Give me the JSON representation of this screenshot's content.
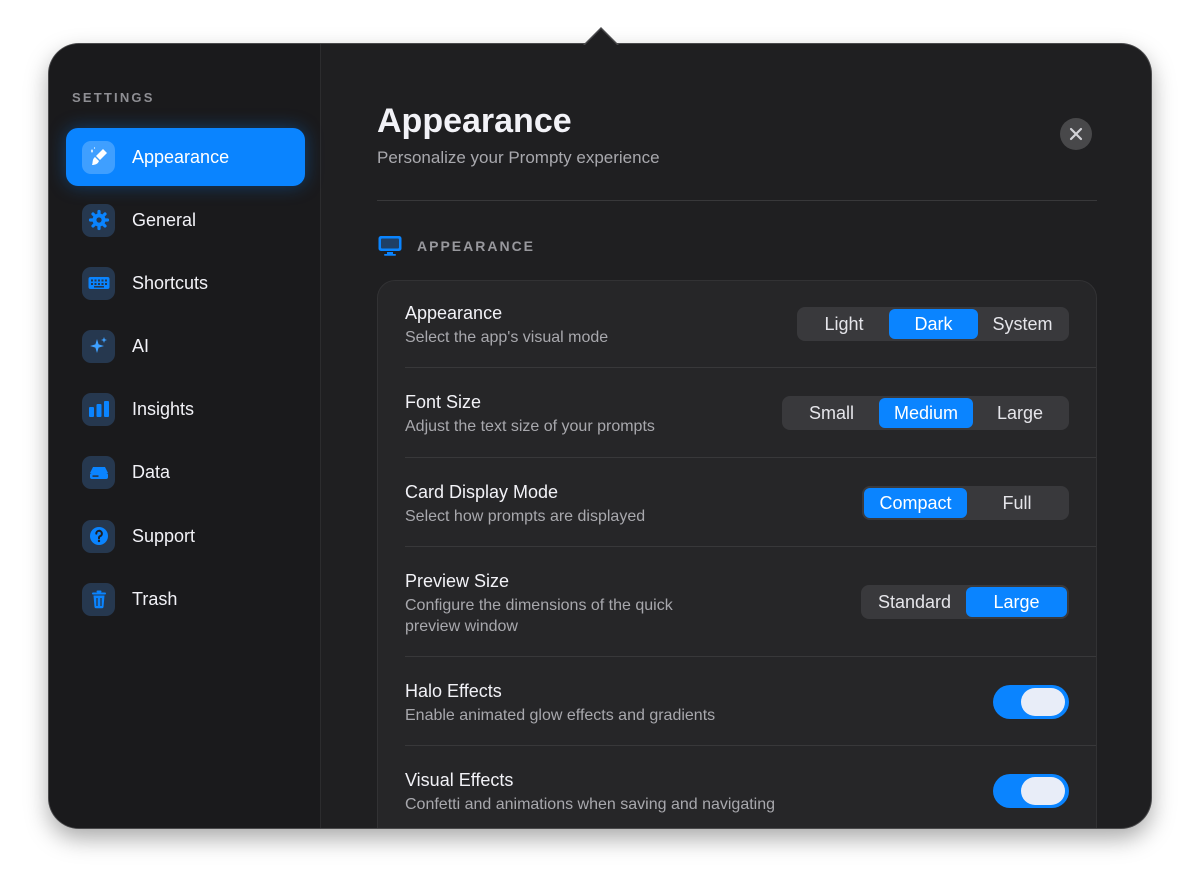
{
  "sidebar": {
    "heading": "SETTINGS",
    "items": [
      {
        "label": "Appearance",
        "icon": "paintbrush-icon",
        "active": true
      },
      {
        "label": "General",
        "icon": "gear-icon"
      },
      {
        "label": "Shortcuts",
        "icon": "keyboard-icon"
      },
      {
        "label": "AI",
        "icon": "sparkles-icon"
      },
      {
        "label": "Insights",
        "icon": "bar-chart-icon"
      },
      {
        "label": "Data",
        "icon": "drive-icon"
      },
      {
        "label": "Support",
        "icon": "question-icon"
      },
      {
        "label": "Trash",
        "icon": "trash-icon"
      }
    ]
  },
  "header": {
    "title": "Appearance",
    "subtitle": "Personalize your Prompty experience"
  },
  "section": {
    "label": "APPEARANCE",
    "icon": "display-icon"
  },
  "settings": [
    {
      "title": "Appearance",
      "description": "Select the app's visual mode",
      "options": [
        "Light",
        "Dark",
        "System"
      ],
      "selected": "Dark"
    },
    {
      "title": "Font Size",
      "description": "Adjust the text size of your prompts",
      "options": [
        "Small",
        "Medium",
        "Large"
      ],
      "selected": "Medium"
    },
    {
      "title": "Card Display Mode",
      "description": "Select how prompts are displayed",
      "options": [
        "Compact",
        "Full"
      ],
      "selected": "Compact"
    },
    {
      "title": "Preview Size",
      "description_line1": "Configure the dimensions of the quick",
      "description_line2": "preview window",
      "options": [
        "Standard",
        "Large"
      ],
      "selected": "Large"
    },
    {
      "title": "Halo Effects",
      "description": "Enable animated glow effects and gradients",
      "toggle": true
    },
    {
      "title": "Visual Effects",
      "description": "Confetti and animations when saving and navigating",
      "toggle": true
    }
  ],
  "colors": {
    "accent": "#0a84ff",
    "background": "#1f1f21",
    "sidebar": "#1a1a1c",
    "card": "#262628"
  }
}
